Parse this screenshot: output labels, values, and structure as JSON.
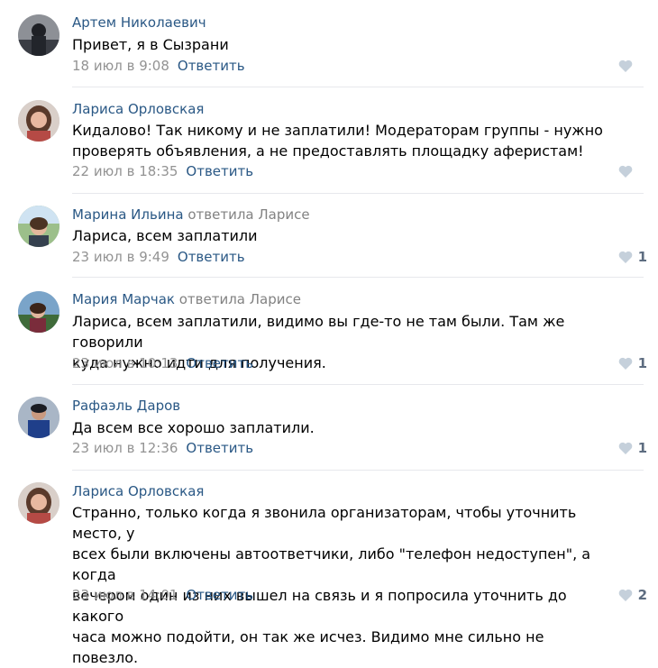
{
  "comments": [
    {
      "author": "Артем Николаевич",
      "reply_to": "",
      "lines": [
        "Привет, я в Сызрани"
      ],
      "date": "18 июл в 9:08",
      "reply_label": "Ответить",
      "likes": ""
    },
    {
      "author": "Лариса Орловская",
      "reply_to": "",
      "lines": [
        "Кидалово! Так никому и не заплатили! Модераторам группы - нужно",
        "проверять объявления, а не предоставлять площадку аферистам!"
      ],
      "date": "22 июл в 18:35",
      "reply_label": "Ответить",
      "likes": ""
    },
    {
      "author": "Марина Ильина",
      "reply_to": "ответила Ларисе",
      "lines": [
        "Лариса, всем заплатили"
      ],
      "date": "23 июл в 9:49",
      "reply_label": "Ответить",
      "likes": "1"
    },
    {
      "author": "Мария Марчак",
      "reply_to": "ответила Ларисе",
      "lines": [
        "Лариса, всем заплатили, видимо вы где-то не там были. Там же говорили",
        "куда нужно идти для получения."
      ],
      "date": "23 июл в 10:13",
      "reply_label": "Ответить",
      "likes": "1"
    },
    {
      "author": "Рафаэль Даров",
      "reply_to": "",
      "lines": [
        "Да всем все хорошо заплатили."
      ],
      "date": "23 июл в 12:36",
      "reply_label": "Ответить",
      "likes": "1"
    },
    {
      "author": "Лариса Орловская",
      "reply_to": "",
      "lines": [
        "Странно, только когда я звонила организаторам, чтобы уточнить место, у",
        "всех были включены автоответчики, либо \"телефон недоступен\", а когда",
        "вечером один из них вышел на связь и я попросила уточнить до какого",
        "часа можно подойти, он так же исчез. Видимо мне сильно не повезло."
      ],
      "date": "23 июл в 14:01",
      "reply_label": "Ответить",
      "likes": "2"
    }
  ],
  "colors": {
    "author": "#2a5885",
    "muted": "#939393",
    "like_icon": "#c5d0db",
    "divider": "#e7e8ec"
  },
  "icons": {
    "like": "heart-icon",
    "avatar": "user-avatar"
  }
}
